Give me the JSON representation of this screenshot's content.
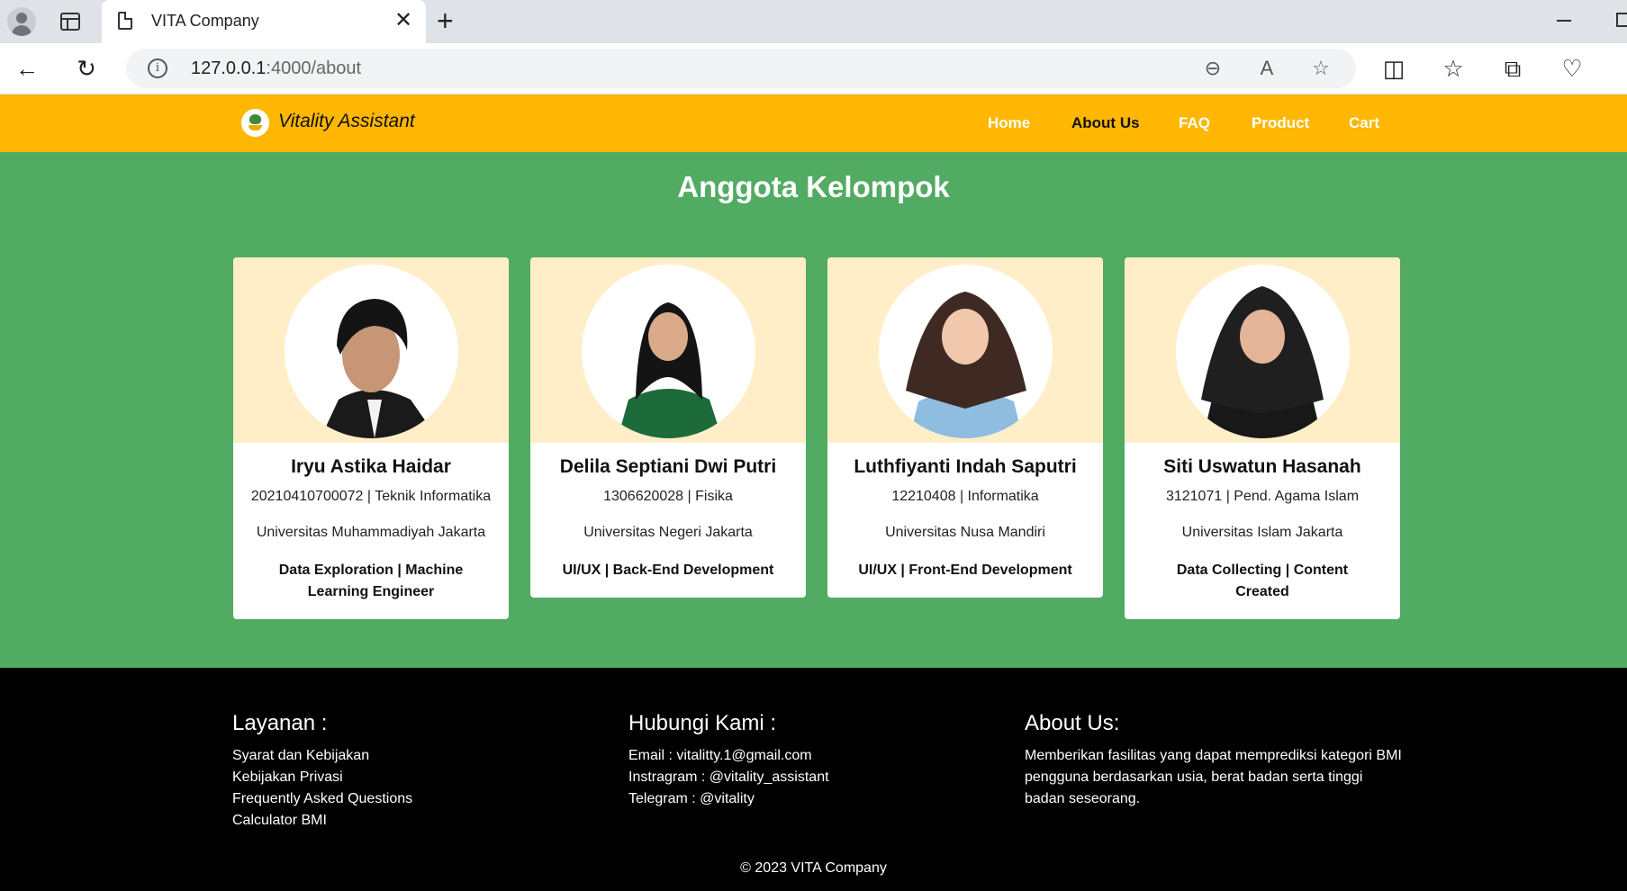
{
  "browser": {
    "tab_title": "VITA Company",
    "url_host": "127.0.0.1",
    "url_path": ":4000/about"
  },
  "header": {
    "brand": "Vitality Assistant",
    "nav": [
      "Home",
      "About Us",
      "FAQ",
      "Product",
      "Cart"
    ],
    "active_index": 1
  },
  "main": {
    "title": "Anggota Kelompok",
    "members": [
      {
        "name": "Iryu Astika Haidar",
        "id_major": "20210410700072 | Teknik Informatika",
        "university": "Universitas Muhammadiyah Jakarta",
        "role": "Data Exploration | Machine Learning Engineer"
      },
      {
        "name": "Delila Septiani Dwi Putri",
        "id_major": "1306620028 | Fisika",
        "university": "Universitas Negeri Jakarta",
        "role": "UI/UX | Back-End Development"
      },
      {
        "name": "Luthfiyanti Indah Saputri",
        "id_major": "12210408 | Informatika",
        "university": "Universitas Nusa Mandiri",
        "role": "UI/UX | Front-End Development"
      },
      {
        "name": "Siti Uswatun Hasanah",
        "id_major": "3121071 | Pend. Agama Islam",
        "university": "Universitas Islam Jakarta",
        "role": "Data Collecting | Content Created"
      }
    ]
  },
  "footer": {
    "services_title": "Layanan :",
    "services": [
      "Syarat dan Kebijakan",
      "Kebijakan Privasi",
      "Frequently Asked Questions",
      "Calculator BMI"
    ],
    "contact_title": "Hubungi Kami :",
    "contacts": [
      "Email : vitalitty.1@gmail.com",
      "Instragram : @vitality_assistant",
      "Telegram : @vitality"
    ],
    "about_title": "About Us:",
    "about_text": "Memberikan fasilitas yang dapat memprediksi kategori BMI pengguna berdasarkan usia, berat badan serta tinggi badan seseorang.",
    "copyright": "© 2023 VITA Company"
  },
  "colors": {
    "header_bg": "#ffb703",
    "main_bg": "#52ab63",
    "card_top_bg": "#ffeec7",
    "footer_bg": "#000000"
  }
}
